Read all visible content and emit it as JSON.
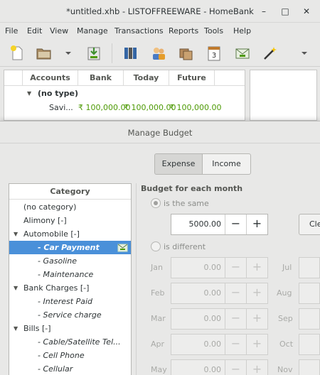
{
  "window": {
    "title": "*untitled.xhb - LISTOFFREEWARE - HomeBank",
    "minimize_glyph": "–",
    "maximize_glyph": "□",
    "close_glyph": "✕"
  },
  "menu": [
    "File",
    "Edit",
    "View",
    "Manage",
    "Transactions",
    "Reports",
    "Tools",
    "Help"
  ],
  "toolbar_icons": [
    "new-file-icon",
    "open-folder-icon",
    "dropdown-arrow-icon",
    "save-icon",
    "accounts-icon",
    "payees-icon",
    "categories-icon",
    "scheduled-icon",
    "budget-icon",
    "assign-icon",
    "overflow-icon"
  ],
  "accounts": {
    "columns": [
      "Accounts",
      "Bank",
      "Today",
      "Future"
    ],
    "group_label": "(no type)",
    "row": {
      "name": "Savi...",
      "bank": "₹ 100,000.00",
      "today": "₹ 100,000.00",
      "future": "₹ 100,000.00"
    },
    "amount_color": "#4e9a06"
  },
  "dialog": {
    "title": "Manage Budget",
    "tabs": [
      "Expense",
      "Income"
    ],
    "active_tab": "Expense",
    "tree_header": "Category",
    "categories": [
      {
        "label": "(no category)",
        "level": 0
      },
      {
        "label": "Alimony [-]",
        "level": 0
      },
      {
        "label": "Automobile [-]",
        "level": 0,
        "expanded": true
      },
      {
        "label": "- Car Payment",
        "level": 1,
        "selected": true
      },
      {
        "label": "- Gasoline",
        "level": 1
      },
      {
        "label": "- Maintenance",
        "level": 1
      },
      {
        "label": "Bank Charges [-]",
        "level": 0,
        "expanded": true
      },
      {
        "label": "- Interest Paid",
        "level": 1
      },
      {
        "label": "- Service charge",
        "level": 1
      },
      {
        "label": "Bills [-]",
        "level": 0,
        "expanded": true
      },
      {
        "label": "- Cable/Satellite Tel...",
        "level": 1
      },
      {
        "label": "- Cell Phone",
        "level": 1
      },
      {
        "label": "- Cellular",
        "level": 1
      }
    ],
    "budget_heading": "Budget for each month",
    "same_label": "is the same",
    "same_value": "5000.00",
    "clear_label": "Cle",
    "different_label": "is different",
    "months_left": [
      {
        "name": "Jan",
        "value": "0.00"
      },
      {
        "name": "Feb",
        "value": "0.00"
      },
      {
        "name": "Mar",
        "value": "0.00"
      },
      {
        "name": "Apr",
        "value": "0.00"
      },
      {
        "name": "May",
        "value": "0.00"
      }
    ],
    "months_right": [
      "Jul",
      "Aug",
      "Sep",
      "Oct",
      "Nov"
    ]
  }
}
